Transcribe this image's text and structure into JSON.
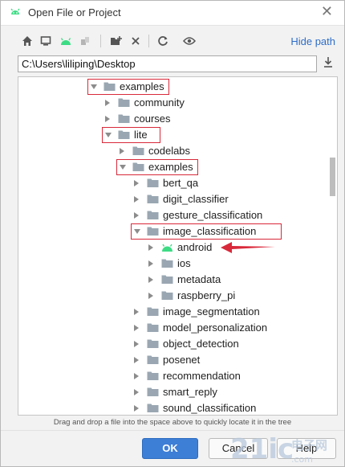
{
  "window": {
    "title": "Open File or Project",
    "close_symbol": "✕"
  },
  "toolbar": {
    "icons": [
      "home-icon",
      "desktop-icon",
      "android-icon",
      "modules-icon",
      "new-folder-icon",
      "delete-icon",
      "refresh-icon",
      "show-hidden-icon"
    ],
    "hide_path_label": "Hide path"
  },
  "path": {
    "value": "C:\\Users\\liliping\\Desktop"
  },
  "tree": {
    "rows": [
      {
        "label": "examples",
        "expanded": true,
        "highlight": true
      },
      {
        "label": "community",
        "expanded": false
      },
      {
        "label": "courses",
        "expanded": false
      },
      {
        "label": "lite",
        "expanded": true,
        "highlight": true
      },
      {
        "label": "codelabs",
        "expanded": false
      },
      {
        "label": "examples",
        "expanded": true,
        "highlight": true
      },
      {
        "label": "bert_qa",
        "expanded": false
      },
      {
        "label": "digit_classifier",
        "expanded": false
      },
      {
        "label": "gesture_classification",
        "expanded": false
      },
      {
        "label": "image_classification",
        "expanded": true,
        "highlight": true
      },
      {
        "label": "android",
        "expanded": false,
        "icon": "android-module-icon",
        "arrow_annotation": true
      },
      {
        "label": "ios",
        "expanded": false
      },
      {
        "label": "metadata",
        "expanded": false
      },
      {
        "label": "raspberry_pi",
        "expanded": false
      },
      {
        "label": "image_segmentation",
        "expanded": false
      },
      {
        "label": "model_personalization",
        "expanded": false
      },
      {
        "label": "object_detection",
        "expanded": false
      },
      {
        "label": "posenet",
        "expanded": false
      },
      {
        "label": "recommendation",
        "expanded": false
      },
      {
        "label": "smart_reply",
        "expanded": false
      },
      {
        "label": "sound_classification",
        "expanded": false
      }
    ]
  },
  "hint": "Drag and drop a file into the space above to quickly locate it in the tree",
  "buttons": {
    "ok": "OK",
    "cancel": "Cancel",
    "help": "Help"
  },
  "watermark": {
    "text": "21ic.com 电子网"
  },
  "colors": {
    "accent": "#3d7ed6",
    "highlight": "#d8293a",
    "android_green": "#3ddc84",
    "folder": "#9aa7b2"
  }
}
